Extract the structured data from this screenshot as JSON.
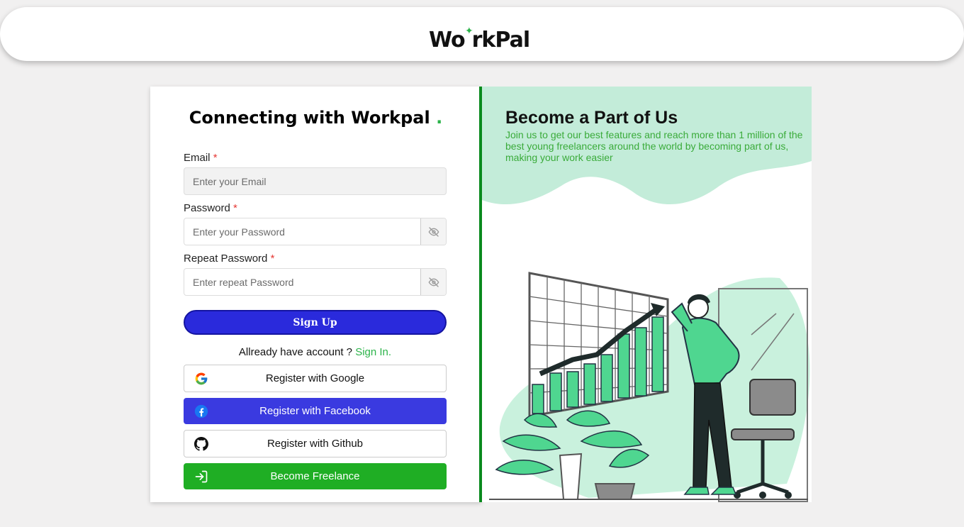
{
  "header": {
    "logo_left": "Wo",
    "logo_right": "rkPal",
    "logo_spark": "✦"
  },
  "form": {
    "title": "Connecting with Workpal",
    "title_dot": ".",
    "email": {
      "label": "Email",
      "required_mark": "*",
      "placeholder": "Enter your Email"
    },
    "password": {
      "label": "Password",
      "required_mark": "*",
      "placeholder": "Enter your Password"
    },
    "repeat_password": {
      "label": "Repeat Password",
      "required_mark": "*",
      "placeholder": "Enter repeat Password"
    },
    "signup_label": "Sign Up",
    "already_text": "Allready have account ?",
    "signin_link": "Sign In."
  },
  "social": {
    "google": "Register with Google",
    "facebook": "Register with Facebook",
    "github": "Register with Github",
    "freelance": "Become Freelance"
  },
  "promo": {
    "title": "Become a Part of Us",
    "text": "Join us to get our best features and reach more than 1 million of the best young freelancers around the world by becoming part of us, making your work easier"
  },
  "icons": [
    "eye-slash-icon",
    "google-icon",
    "facebook-icon",
    "github-icon",
    "sign-in-icon"
  ],
  "colors": {
    "accent": "#2cb34a",
    "primary": "#2a2adc",
    "facebook": "#3a3ae0",
    "freelance": "#1fae24",
    "divider": "#0a8a1e",
    "mint": "#c3ecd9"
  }
}
